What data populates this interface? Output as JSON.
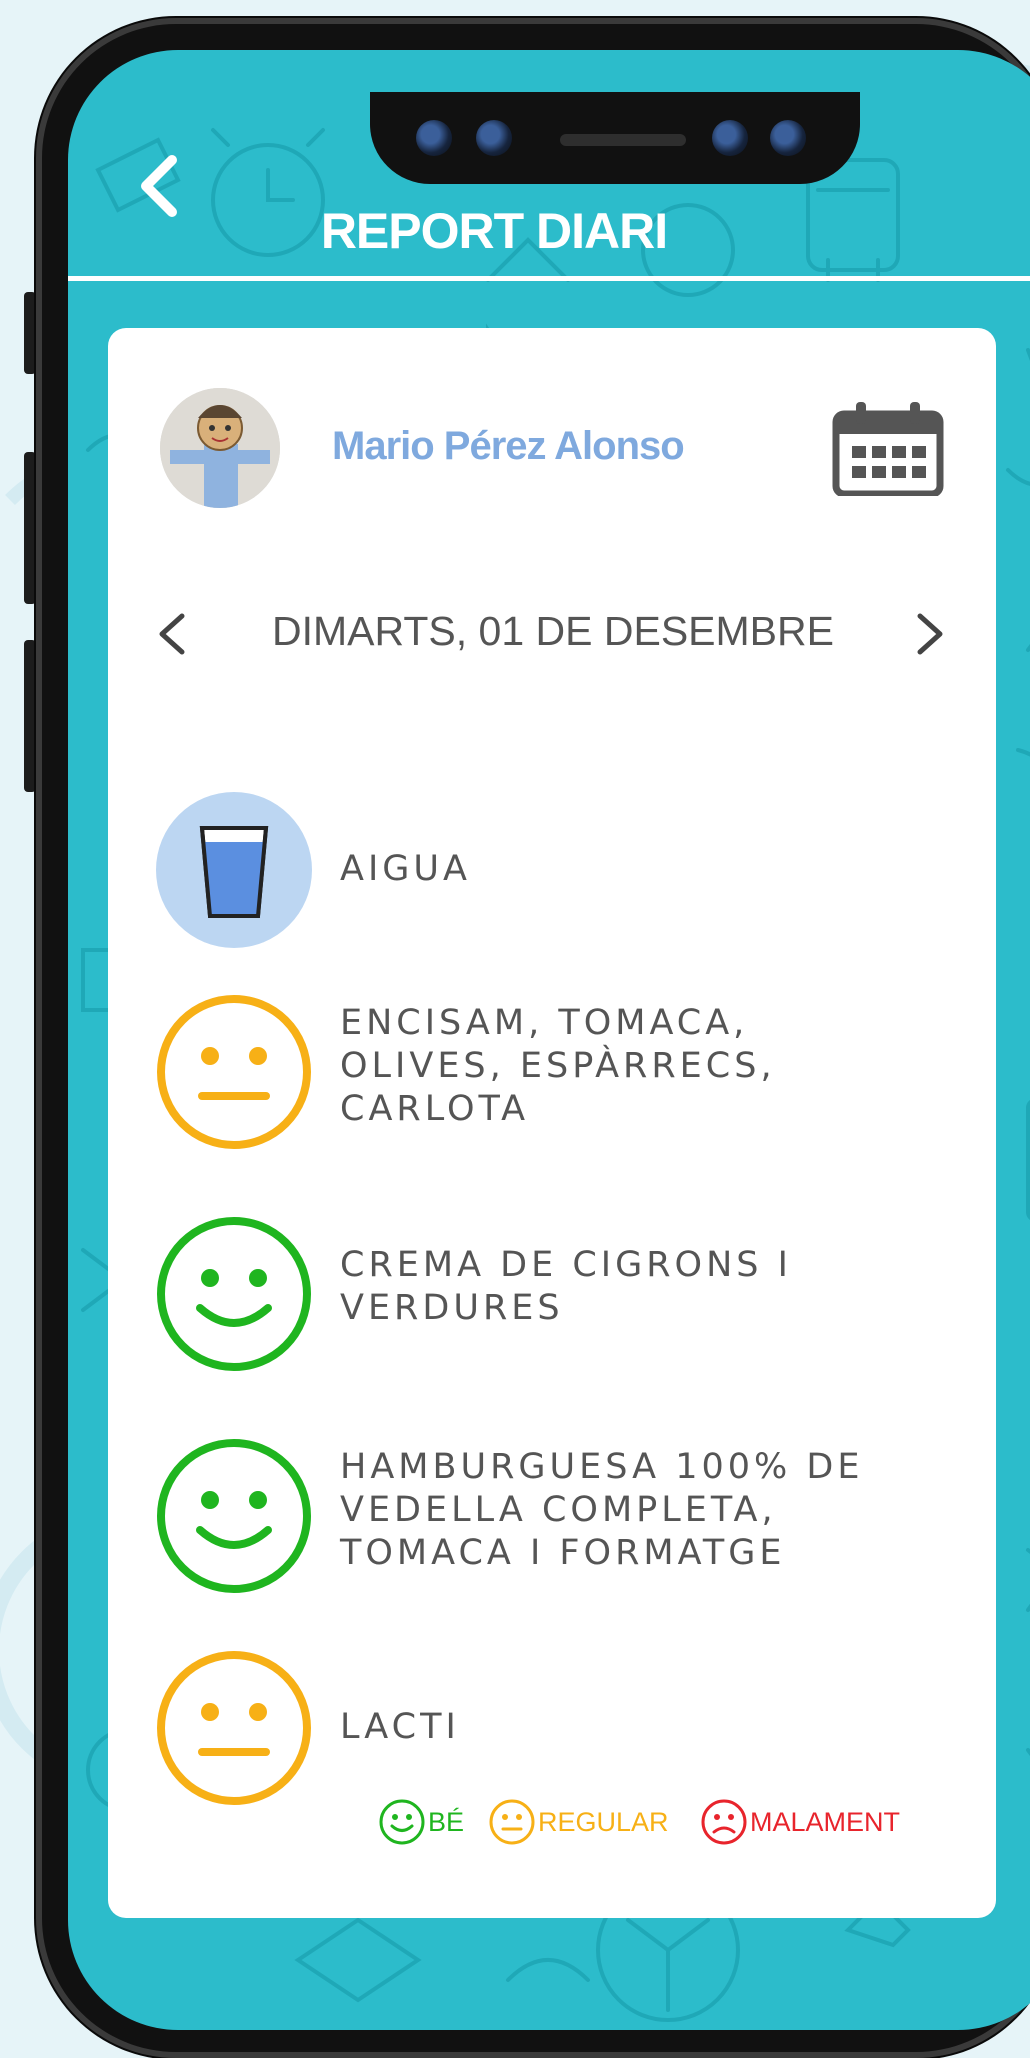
{
  "header": {
    "title": "REPORT DIARI"
  },
  "child": {
    "name": "Mario Pérez Alonso"
  },
  "date": {
    "label": "DIMARTS, 01 DE DESEMBRE"
  },
  "meals": [
    {
      "icon": "water-glass-icon",
      "rating": "none",
      "text": "AIGUA"
    },
    {
      "icon": "neutral-face-icon",
      "rating": "regular",
      "text": "ENCISAM, TOMACA,\nOLIVES, ESPÀRRECS,\nCARLOTA"
    },
    {
      "icon": "happy-face-icon",
      "rating": "good",
      "text": "CREMA DE CIGRONS I\nVERDURES"
    },
    {
      "icon": "happy-face-icon",
      "rating": "good",
      "text": "HAMBURGUESA 100% DE\nVEDELLA COMPLETA,\nTOMACA I FORMATGE"
    },
    {
      "icon": "neutral-face-icon",
      "rating": "regular",
      "text": "LACTI"
    }
  ],
  "legend": {
    "good": "BÉ",
    "regular": "REGULAR",
    "bad": "MALAMENT"
  },
  "colors": {
    "teal": "#2cbccb",
    "good": "#1fb51f",
    "regular": "#f7b016",
    "bad": "#e8242c",
    "name": "#7fa9de",
    "water": "#bcd6f2"
  }
}
